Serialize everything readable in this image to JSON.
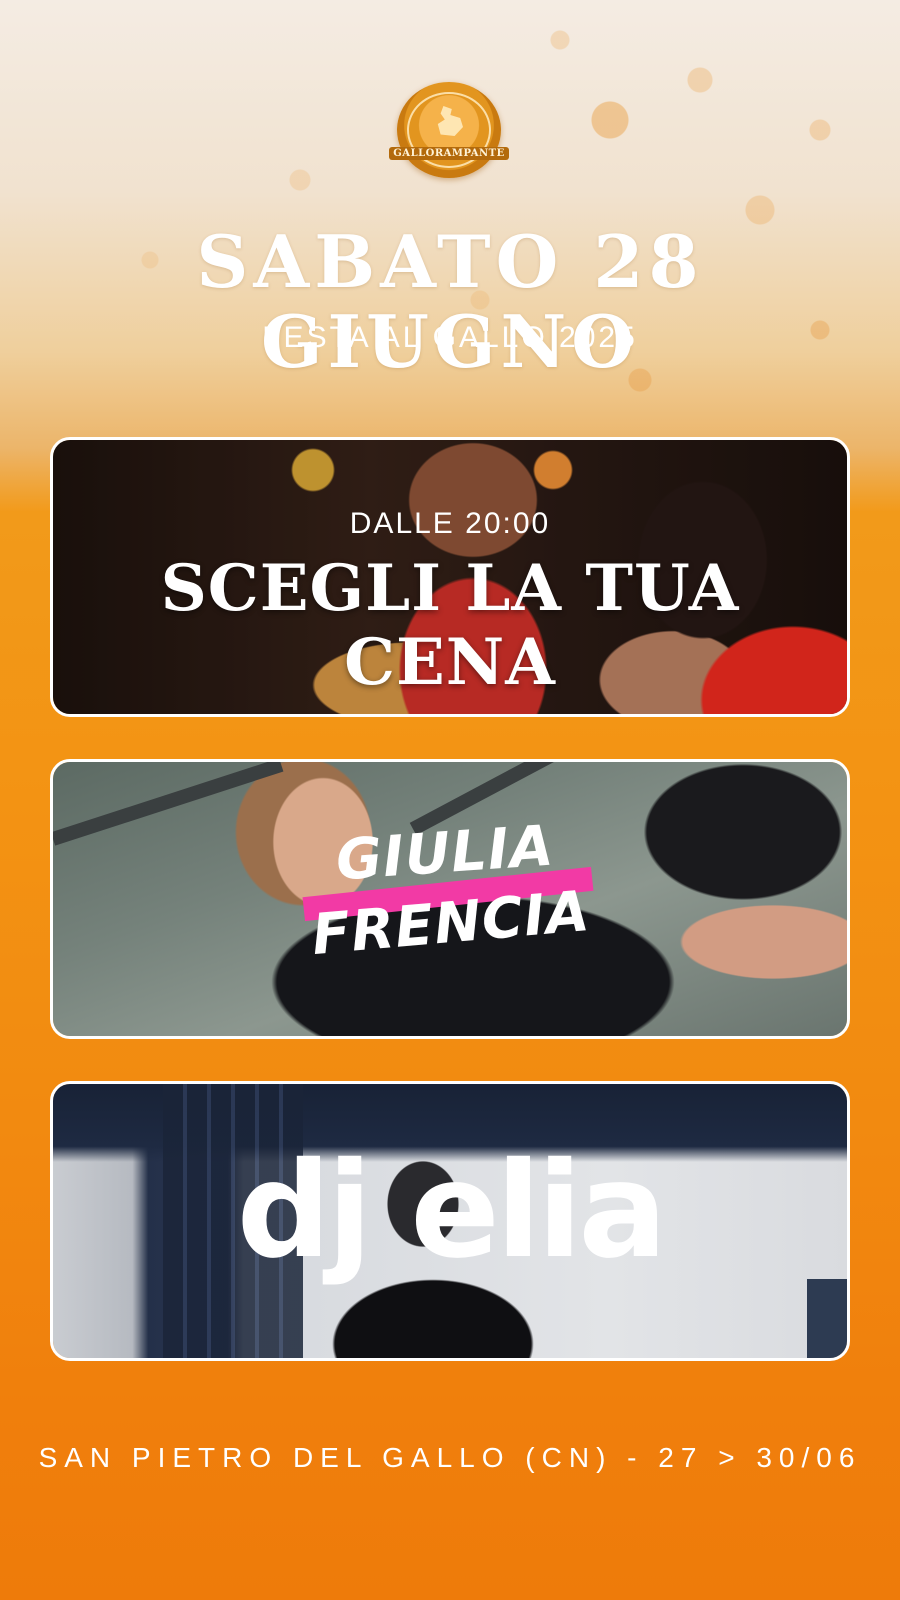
{
  "logo": {
    "text": "GALLORAMPANTE"
  },
  "header": {
    "title": "SABATO 28 GIUGNO",
    "subtitle": "FESTA AL GALLO 2025"
  },
  "cards": [
    {
      "time": "DALLE 20:00",
      "title": "SCEGLI LA TUA CENA"
    },
    {
      "name_top": "GIULIA",
      "name_bottom": "FRENCIA",
      "accent": "#f23aa5"
    },
    {
      "logo_text": "dj elia"
    }
  ],
  "footer": {
    "text": "SAN PIETRO DEL GALLO (CN) - 27 > 30/06"
  },
  "colors": {
    "beer_orange": "#f39313",
    "foam": "#f4ece3"
  }
}
